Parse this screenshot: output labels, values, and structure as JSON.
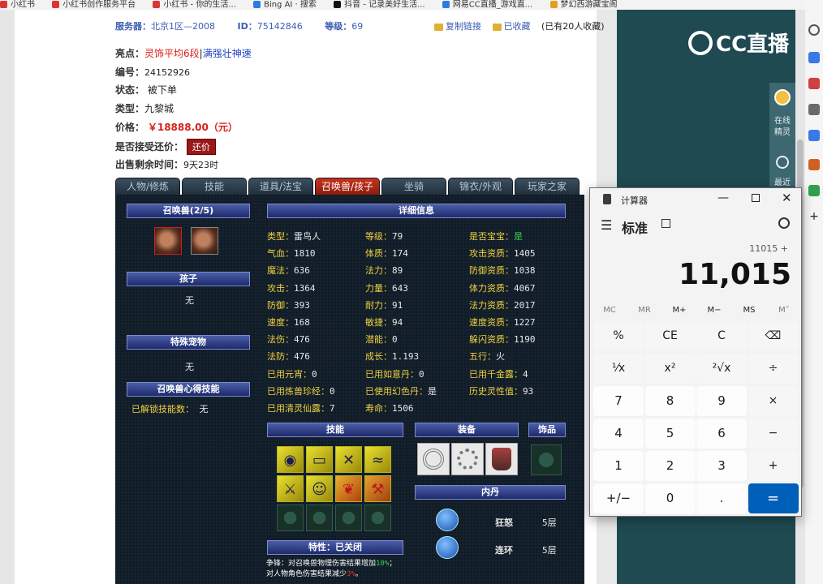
{
  "bookmarks": [
    "小红书",
    "小红书创作服务平台",
    "小红书 - 你的生活...",
    "Bing AI · 搜索",
    "抖音 - 记录美好生活...",
    "网易CC直播_游戏直...",
    "梦幻西游藏宝阁"
  ],
  "listing": {
    "server_label": "服务器：",
    "server": "北京1区—2008",
    "id_label": "ID：",
    "id": "75142846",
    "level_label": "等级：",
    "level": "69",
    "copy_link": "复制链接",
    "favorited": "已收藏",
    "fav_count_text": "(已有20人收藏)",
    "highlights_label": "亮点：",
    "highlight_1": "灵饰平均6段",
    "highlight_2": "满强壮神速",
    "serial_label": "编号：",
    "serial": "24152926",
    "status_label": "状态：",
    "status": "被下单",
    "type_label": "类型：",
    "type": "九黎城",
    "price_label": "价格：",
    "price": "￥18888.00（元）",
    "bargain_label": "是否接受还价：",
    "bargain_button": "还价",
    "remaining_label": "出售剩余时间：",
    "remaining": "9天23时"
  },
  "tabs": [
    "人物/修炼",
    "技能",
    "道具/法宝",
    "召唤兽/孩子",
    "坐骑",
    "锦衣/外观",
    "玩家之家"
  ],
  "active_tab": 3,
  "panel": {
    "pets_header": "召唤兽(2/5)",
    "child_header": "孩子",
    "child_value": "无",
    "special_pet_header": "特殊宠物",
    "special_pet_value": "无",
    "pet_skill_header": "召唤兽心得技能",
    "unlocked_label": "已解锁技能数：",
    "unlocked_value": "无",
    "detail_header": "详细信息",
    "skills_header": "技能",
    "equip_header": "装备",
    "ornament_header": "饰品",
    "neidan_header": "内丹",
    "trait_header": "特性：已关闭",
    "trait_line1_prefix": "争锋：对召唤兽物理伤害结果增加",
    "trait_line1_value": "10%",
    "trait_line1_suffix": "；",
    "trait_line2_prefix": "对人物角色伤害结果减少",
    "trait_line2_value": "3%",
    "trait_line2_suffix": "。"
  },
  "stats": {
    "col1": [
      {
        "k": "类型：",
        "v": "雷鸟人"
      },
      {
        "k": "气血：",
        "v": "1810"
      },
      {
        "k": "魔法：",
        "v": "636"
      },
      {
        "k": "攻击：",
        "v": "1364"
      },
      {
        "k": "防御：",
        "v": "393"
      },
      {
        "k": "速度：",
        "v": "168"
      },
      {
        "k": "法伤：",
        "v": "476"
      },
      {
        "k": "法防：",
        "v": "476"
      },
      {
        "k": "已用元宵：",
        "v": "0"
      },
      {
        "k": "已用炼兽珍经：",
        "v": "0"
      },
      {
        "k": "已用清灵仙露：",
        "v": "7"
      }
    ],
    "col2": [
      {
        "k": "等级：",
        "v": "79"
      },
      {
        "k": "体质：",
        "v": "174"
      },
      {
        "k": "法力：",
        "v": "89"
      },
      {
        "k": "力量：",
        "v": "643"
      },
      {
        "k": "耐力：",
        "v": "91"
      },
      {
        "k": "敏捷：",
        "v": "94"
      },
      {
        "k": "潜能：",
        "v": "0"
      },
      {
        "k": "成长：",
        "v": "1.193"
      },
      {
        "k": "已用如意丹：",
        "v": "0"
      },
      {
        "k": "已使用幻色丹：",
        "v": "是"
      },
      {
        "k": "寿命：",
        "v": "1506"
      }
    ],
    "col3": [
      {
        "k": "是否宝宝：",
        "v": "是"
      },
      {
        "k": "攻击资质：",
        "v": "1405"
      },
      {
        "k": "防御资质：",
        "v": "1038"
      },
      {
        "k": "体力资质：",
        "v": "4067"
      },
      {
        "k": "法力资质：",
        "v": "2017"
      },
      {
        "k": "速度资质：",
        "v": "1227"
      },
      {
        "k": "躲闪资质：",
        "v": "1190"
      },
      {
        "k": "五行：",
        "v": "火"
      },
      {
        "k": "已用千金露：",
        "v": "4"
      },
      {
        "k": "历史灵性值：",
        "v": "93"
      }
    ]
  },
  "neidan": [
    {
      "name": "狂怒",
      "level": "5层"
    },
    {
      "name": "连环",
      "level": "5层"
    }
  ],
  "sidebar": {
    "logo": "CC直播",
    "online_label_1": "在线",
    "online_label_2": "精灵",
    "recent_label": "最近"
  },
  "calculator": {
    "title": "计算器",
    "mode": "标准",
    "expression": "11015 +",
    "display": "11,015",
    "memory": [
      "MC",
      "MR",
      "M+",
      "M−",
      "MS",
      "M˅"
    ],
    "keys": [
      [
        "%",
        "CE",
        "C",
        "⌫"
      ],
      [
        "⅟x",
        "x²",
        "²√x",
        "÷"
      ],
      [
        "7",
        "8",
        "9",
        "×"
      ],
      [
        "4",
        "5",
        "6",
        "−"
      ],
      [
        "1",
        "2",
        "3",
        "+"
      ],
      [
        "+/−",
        "0",
        ".",
        "="
      ]
    ]
  }
}
